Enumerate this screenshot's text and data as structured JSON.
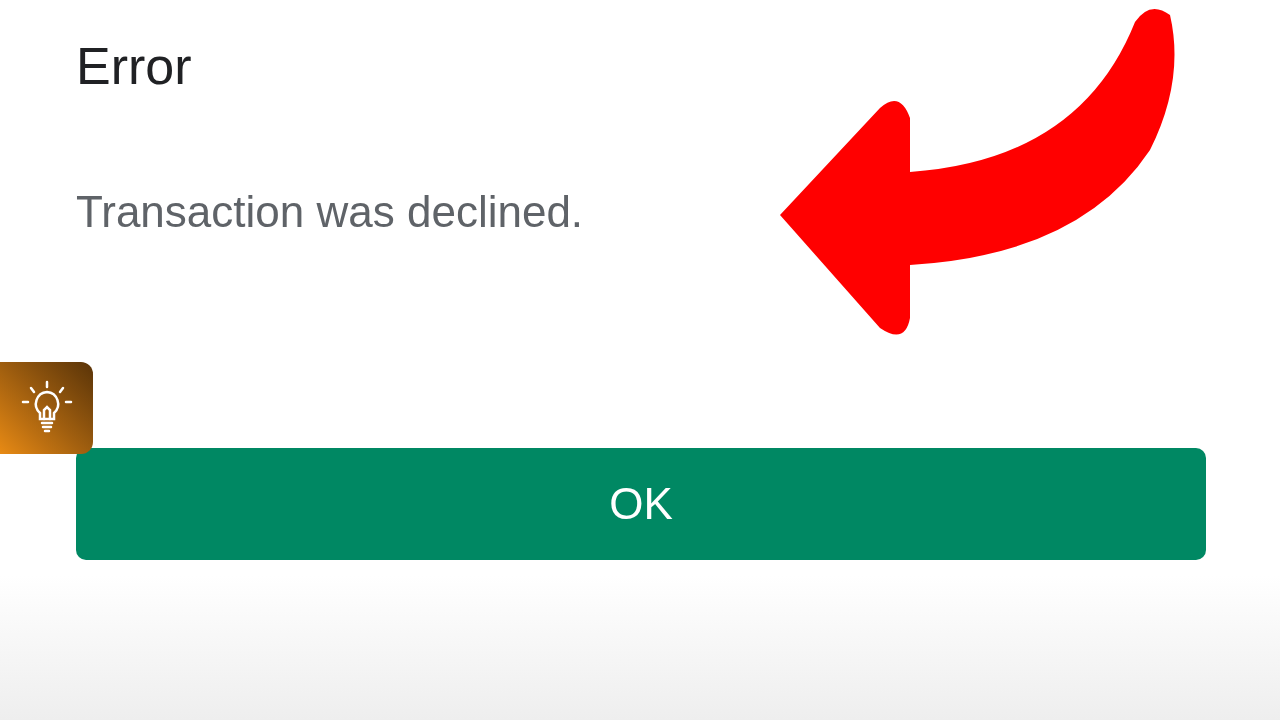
{
  "dialog": {
    "title": "Error",
    "message": "Transaction was declined.",
    "button": "OK"
  }
}
